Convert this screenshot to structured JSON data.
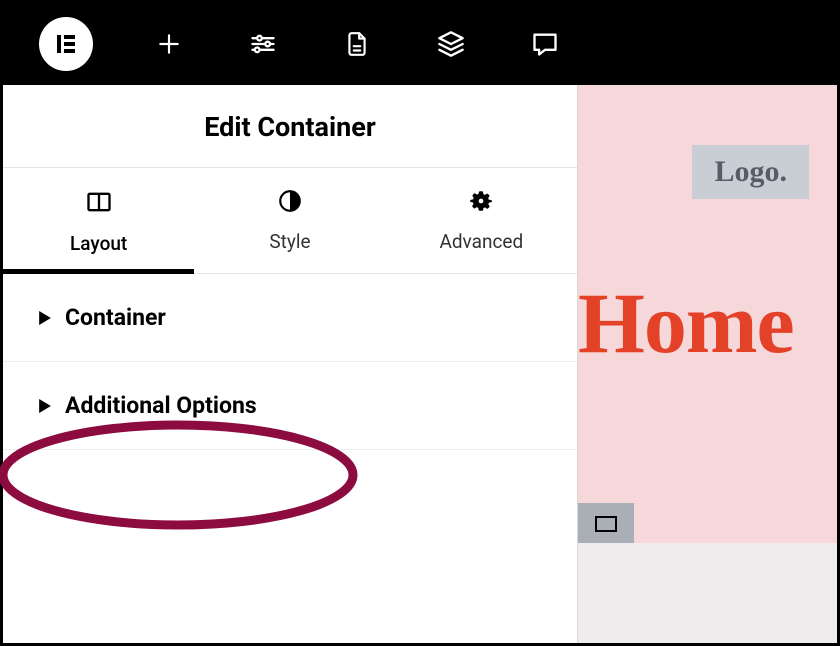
{
  "topbar": {
    "items": [
      "add",
      "settings",
      "page",
      "layers",
      "chat"
    ]
  },
  "panel": {
    "title": "Edit Container",
    "tabs": [
      {
        "label": "Layout"
      },
      {
        "label": "Style"
      },
      {
        "label": "Advanced"
      }
    ],
    "sections": [
      {
        "label": "Container"
      },
      {
        "label": "Additional Options"
      }
    ]
  },
  "preview": {
    "logo": "Logo.",
    "headline": "Home"
  }
}
